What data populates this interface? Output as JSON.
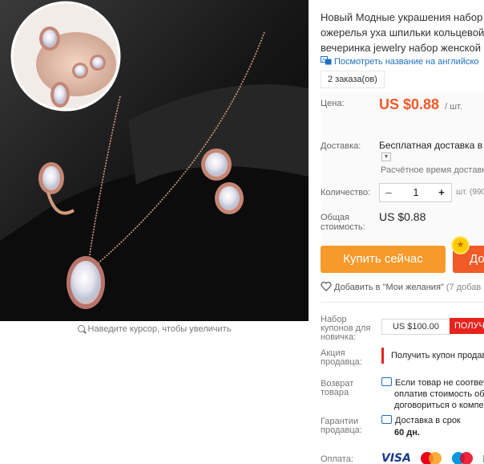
{
  "product": {
    "title_lines": [
      "Новый Модные украшения набор",
      "ожерелья уха шпильки кольцевой",
      "вечеринка jewelry набор женской"
    ],
    "translate_link": "Посмотреть название на английско",
    "orders": "2 заказа(ов)"
  },
  "gallery": {
    "zoom_hint": "Наведите курсор, чтобы увеличить"
  },
  "pricing": {
    "price_label": "Цена:",
    "price": "US $0.88",
    "unit": "/ шт.",
    "shipping_label": "Доставка:",
    "shipping_value": "Бесплатная доставка в R",
    "shipping_estimate": "Расчётное время доставки",
    "quantity_label": "Количество:",
    "quantity_value": "1",
    "quantity_minus": "–",
    "quantity_plus": "+",
    "stock": "шт. (990",
    "total_label_line1": "Общая",
    "total_label_line2": "стоимость:",
    "total_value": "US $0.88"
  },
  "actions": {
    "buy_now": "Купить сейчас",
    "add_to_cart": "До",
    "wishlist": "Добавить в \"Мои желания\"",
    "wishlist_count": "(7 добав"
  },
  "coupons": {
    "label_lines": [
      "Набор",
      "купонов для",
      "новичка:"
    ],
    "amount": "US $100.00",
    "get_button": "ПОЛУЧ"
  },
  "seller_promo": {
    "label_lines": [
      "Акция",
      "продавца:"
    ],
    "text": "Получить купон продав"
  },
  "returns": {
    "label_lines": [
      "Возврат",
      "товара"
    ],
    "lines": [
      "Если товар не соответс",
      "оплатив стоимость обр",
      "договориться о компен"
    ]
  },
  "guarantee": {
    "label_lines": [
      "Гарантии",
      "продавца:"
    ],
    "line1": "Доставка в срок",
    "line2": "60 дн."
  },
  "payment": {
    "label": "Оплата:",
    "visa": "VISA",
    "mir": "M"
  }
}
